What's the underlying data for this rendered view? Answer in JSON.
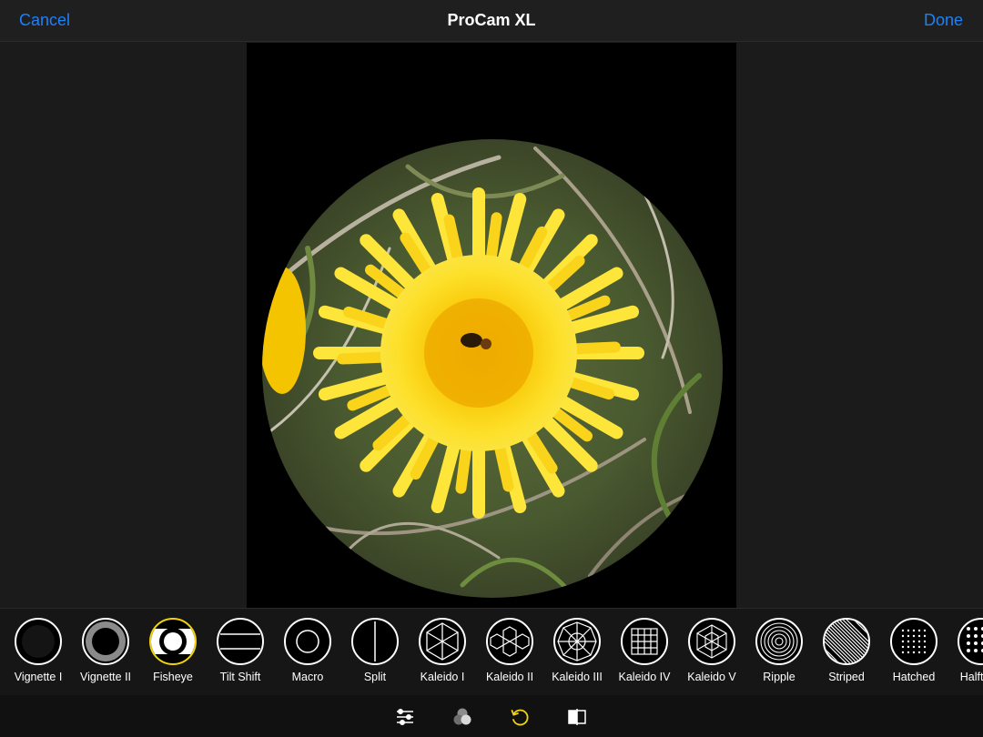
{
  "navbar": {
    "cancel_label": "Cancel",
    "title": "ProCam XL",
    "done_label": "Done"
  },
  "colors": {
    "accent_blue": "#1a82fb",
    "selected_ring": "#f2d40d",
    "toolbar_active": "#f2d40d"
  },
  "filters": [
    {
      "label": "Vignette I",
      "icon": "vignette-1-icon"
    },
    {
      "label": "Vignette II",
      "icon": "vignette-2-icon"
    },
    {
      "label": "Fisheye",
      "icon": "fisheye-icon",
      "selected": true
    },
    {
      "label": "Tilt Shift",
      "icon": "tilt-shift-icon"
    },
    {
      "label": "Macro",
      "icon": "macro-icon"
    },
    {
      "label": "Split",
      "icon": "split-icon"
    },
    {
      "label": "Kaleido I",
      "icon": "kaleido-1-icon"
    },
    {
      "label": "Kaleido II",
      "icon": "kaleido-2-icon"
    },
    {
      "label": "Kaleido III",
      "icon": "kaleido-3-icon"
    },
    {
      "label": "Kaleido IV",
      "icon": "kaleido-4-icon"
    },
    {
      "label": "Kaleido V",
      "icon": "kaleido-5-icon"
    },
    {
      "label": "Ripple",
      "icon": "ripple-icon"
    },
    {
      "label": "Striped",
      "icon": "striped-icon"
    },
    {
      "label": "Hatched",
      "icon": "hatched-icon"
    },
    {
      "label": "Halftone",
      "icon": "halftone-icon"
    }
  ],
  "toolbar": {
    "tools": [
      {
        "icon": "adjustments-sliders-icon"
      },
      {
        "icon": "color-filters-icon"
      },
      {
        "icon": "rotate-icon",
        "active": true
      },
      {
        "icon": "compare-split-icon"
      }
    ]
  }
}
